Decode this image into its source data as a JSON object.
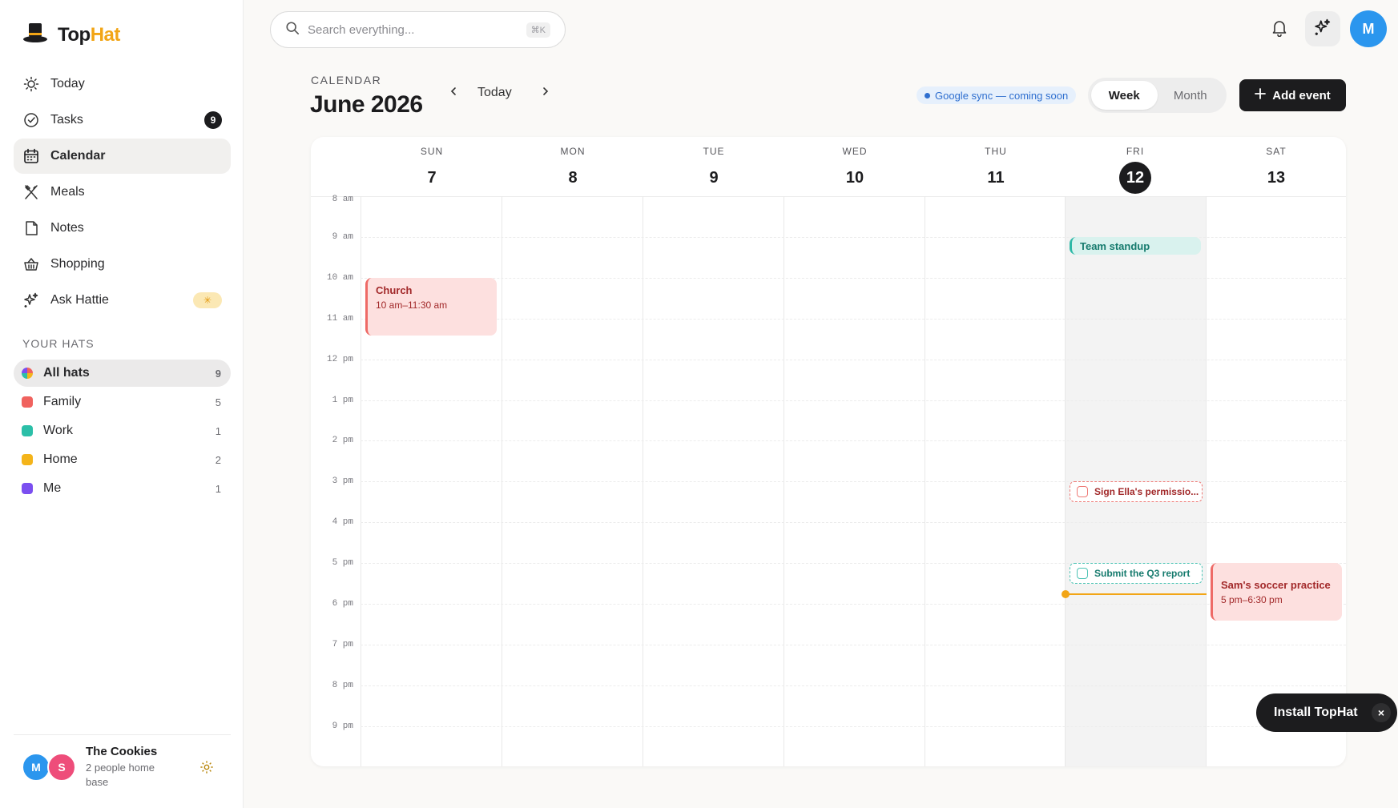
{
  "app": {
    "logo_top": "Top",
    "logo_hat": "Hat"
  },
  "sidebar": {
    "nav": [
      {
        "label": "Today",
        "icon": "sun-icon"
      },
      {
        "label": "Tasks",
        "icon": "check-circle-icon",
        "badge": "9"
      },
      {
        "label": "Calendar",
        "icon": "calendar-icon",
        "active": true
      },
      {
        "label": "Meals",
        "icon": "utensils-icon"
      },
      {
        "label": "Notes",
        "icon": "note-icon"
      },
      {
        "label": "Shopping",
        "icon": "basket-icon"
      },
      {
        "label": "Ask Hattie",
        "icon": "sparkle-icon",
        "badge_icon": "sparkle-icon"
      }
    ],
    "hats_title": "YOUR HATS",
    "hats": [
      {
        "label": "All hats",
        "count": "9",
        "color": "multicolor",
        "active": true
      },
      {
        "label": "Family",
        "count": "5",
        "color": "#f0625e"
      },
      {
        "label": "Work",
        "count": "1",
        "color": "#2bbfa8"
      },
      {
        "label": "Home",
        "count": "2",
        "color": "#f4b41a"
      },
      {
        "label": "Me",
        "count": "1",
        "color": "#7b4ff0"
      }
    ],
    "footer": {
      "family_name": "The Cookies",
      "subtitle": "2 people home base",
      "avatars": [
        {
          "initial": "M",
          "color": "#2b96ee"
        },
        {
          "initial": "S",
          "color": "#ee4d7a"
        }
      ]
    }
  },
  "topbar": {
    "search_placeholder": "Search everything...",
    "search_shortcut": "⌘K",
    "user_initial": "M"
  },
  "calendar": {
    "kicker": "CALENDAR",
    "title": "June 2026",
    "today_label": "Today",
    "sync_badge": "Google sync — coming soon",
    "view_week": "Week",
    "view_month": "Month",
    "active_view": "Week",
    "add_event_label": "Add event",
    "days": [
      {
        "dow": "SUN",
        "num": "7"
      },
      {
        "dow": "MON",
        "num": "8"
      },
      {
        "dow": "TUE",
        "num": "9"
      },
      {
        "dow": "WED",
        "num": "10"
      },
      {
        "dow": "THU",
        "num": "11"
      },
      {
        "dow": "FRI",
        "num": "12",
        "today": true
      },
      {
        "dow": "SAT",
        "num": "13"
      }
    ],
    "hours": [
      "8 am",
      "9 am",
      "10 am",
      "11 am",
      "12 pm",
      "1 pm",
      "2 pm",
      "3 pm",
      "4 pm",
      "5 pm",
      "6 pm",
      "7 pm",
      "8 pm",
      "9 pm"
    ],
    "events": {
      "church": {
        "title": "Church",
        "time": "10 am–11:30 am"
      },
      "standup": {
        "title": "Team standup"
      },
      "permission": {
        "title": "Sign Ella's permissio..."
      },
      "q3": {
        "title": "Submit the Q3 report"
      },
      "soccer": {
        "title": "Sam's soccer practice",
        "time": "5 pm–6:30 pm"
      }
    }
  },
  "install_toast": {
    "label": "Install TopHat",
    "close": "×"
  }
}
